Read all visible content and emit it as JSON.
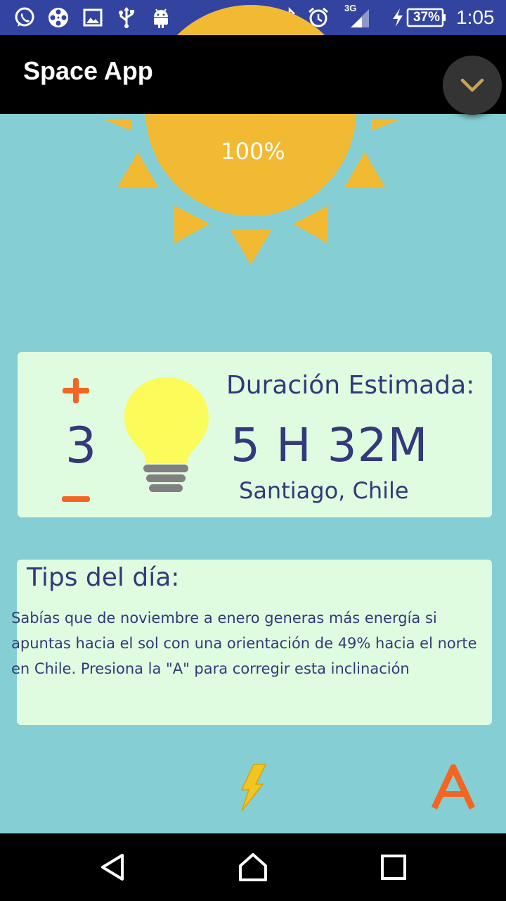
{
  "status_bar": {
    "left_icons": [
      "whatsapp-icon",
      "film-reel-icon",
      "image-icon",
      "usb-icon",
      "android-icon"
    ],
    "right_icons": [
      "bluetooth-icon",
      "alarm-icon",
      "signal-3g-icon",
      "battery-icon"
    ],
    "network": "3G",
    "battery_percent": "37%",
    "time": "1:05"
  },
  "app_bar": {
    "title": "Space App",
    "dropdown_icon": "chevron-down-icon"
  },
  "sun": {
    "percent_label": "100%",
    "color": "#f2ba32"
  },
  "duration_card": {
    "plus_icon": "plus-icon",
    "minus_icon": "minus-icon",
    "count": "3",
    "bulb_icon": "lightbulb-icon",
    "title": "Duración Estimada:",
    "value": "5 H 32M",
    "location": "Santiago, Chile"
  },
  "tips_card": {
    "title": "Tips del día:",
    "body": "Sabías que de noviembre a enero generas más energía si apuntas hacia el sol con una orientación de 49% hacia el norte en Chile.  Presiona la \"A\" para corregir esta inclinación"
  },
  "bottom_actions": {
    "bolt_icon": "lightning-bolt-icon",
    "a_label": "A"
  },
  "nav_bar": {
    "buttons": [
      "back-icon",
      "home-icon",
      "recents-icon"
    ]
  },
  "colors": {
    "background": "#85cfd4",
    "card": "#e0fce0",
    "text": "#33397a",
    "accent_orange": "#f26522",
    "status_bar": "#3344a0"
  }
}
